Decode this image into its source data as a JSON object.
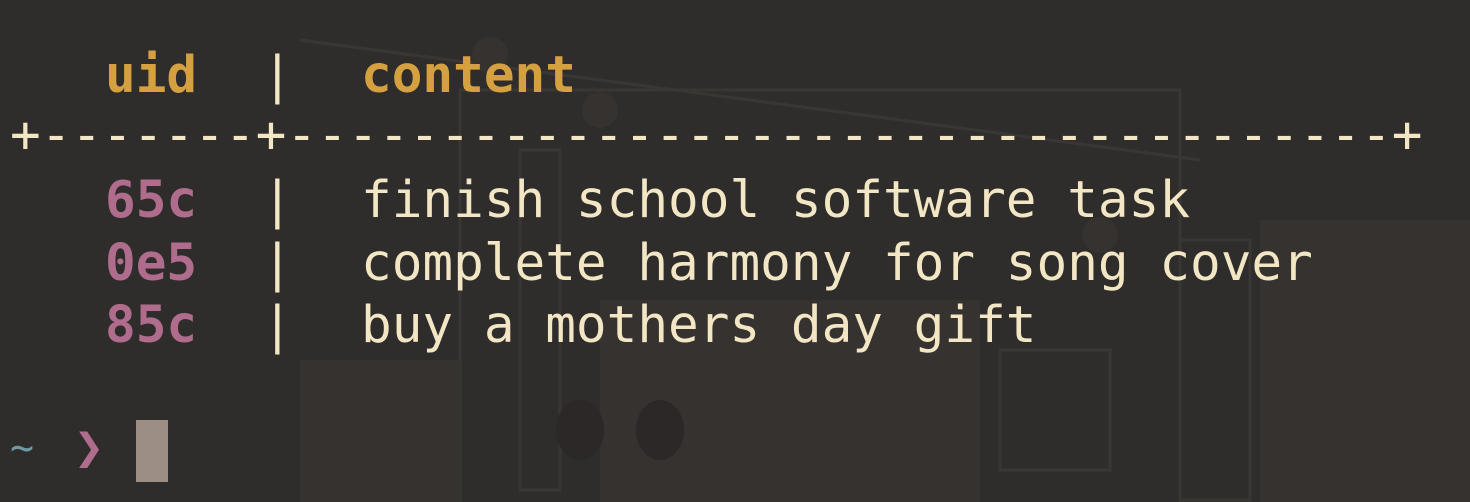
{
  "table": {
    "header": {
      "uid": "uid",
      "separator": "|",
      "content": "content"
    },
    "divider": "+-------+------------------------------------+",
    "rows": [
      {
        "uid": "65c",
        "separator": "|",
        "content": "finish school software task"
      },
      {
        "uid": "0e5",
        "separator": "|",
        "content": "complete harmony for song cover"
      },
      {
        "uid": "85c",
        "separator": "|",
        "content": "buy a mothers day gift"
      }
    ]
  },
  "prompt": {
    "cwd": "~",
    "symbol": "❯"
  },
  "colors": {
    "background": "#2f2d2b",
    "header": "#d5a040",
    "uid": "#b06c8c",
    "text": "#f3e6c4",
    "cwd": "#6f9aa0",
    "cursor": "#9c8e84"
  }
}
